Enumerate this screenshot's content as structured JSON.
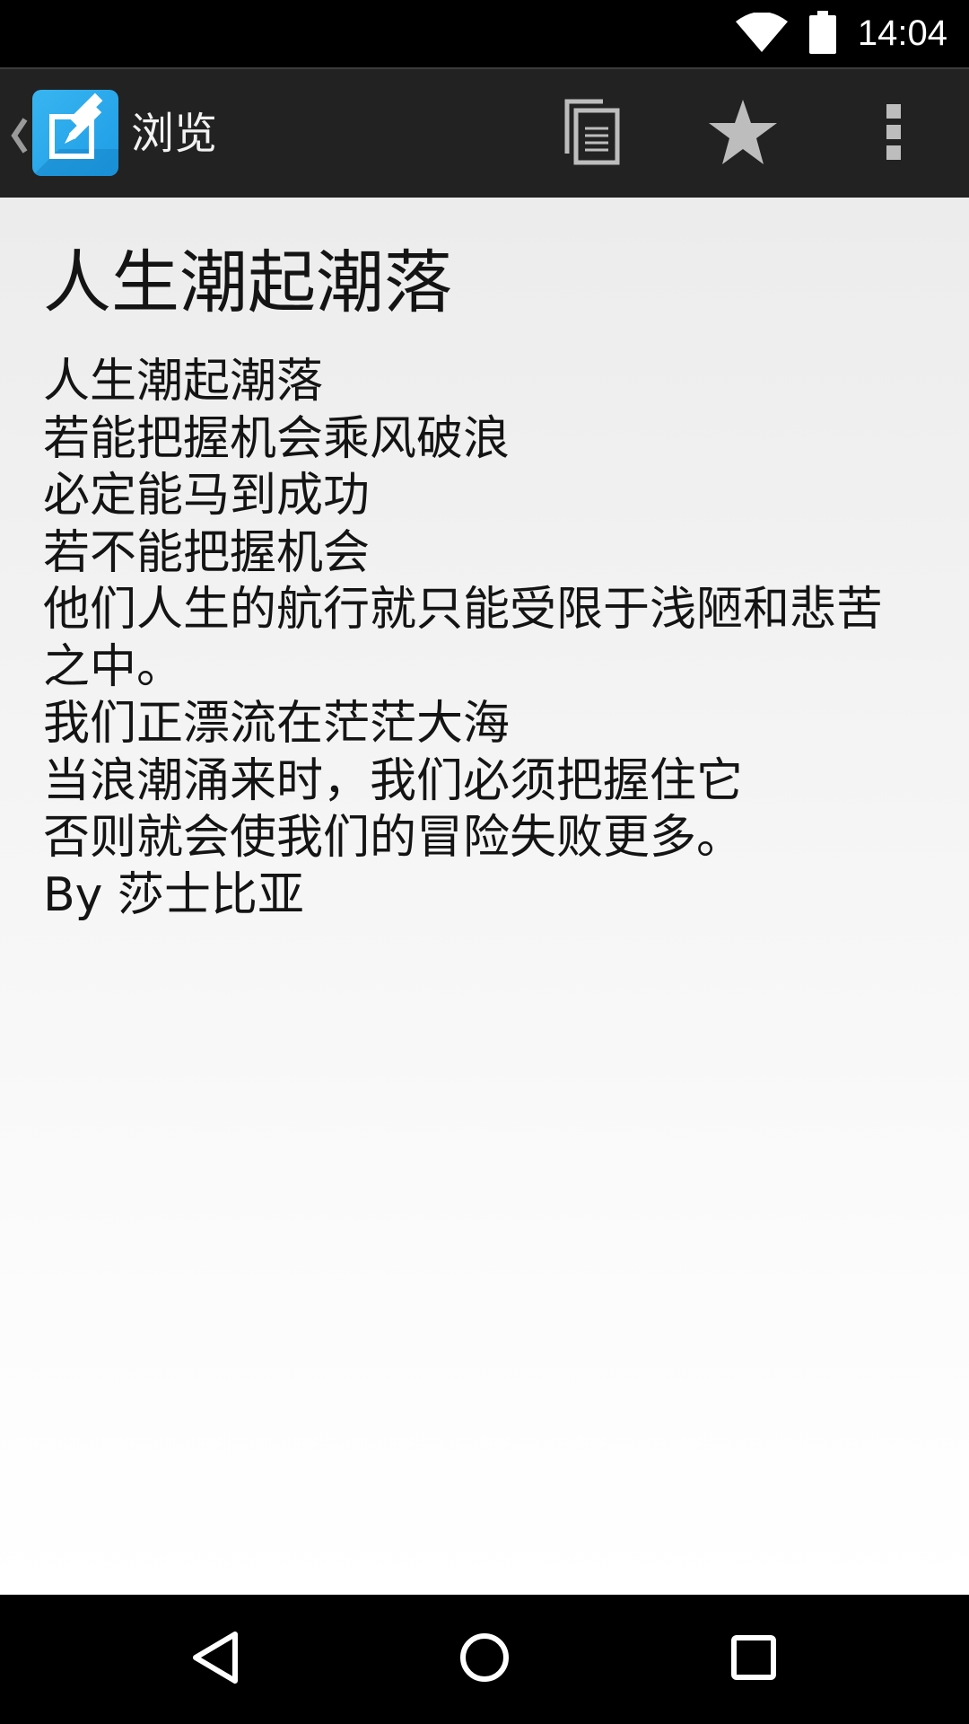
{
  "status_bar": {
    "time": "14:04",
    "icons": [
      "wifi-icon",
      "battery-icon"
    ]
  },
  "action_bar": {
    "title": "浏览",
    "icons": [
      "back-chevron-icon",
      "app-edit-icon",
      "copy-icon",
      "star-icon",
      "overflow-menu-icon"
    ]
  },
  "note": {
    "title": "人生潮起潮落",
    "lines": [
      "人生潮起潮落",
      "若能把握机会乘风破浪",
      "必定能马到成功",
      "若不能把握机会",
      "他们人生的航行就只能受限于浅陋和悲苦",
      "之中。",
      "我们正漂流在茫茫大海",
      "当浪潮涌来时，我们必须把握住它",
      "否则就会使我们的冒险失败更多。",
      "By 莎士比亚"
    ]
  },
  "nav_bar": {
    "icons": [
      "back-triangle-icon",
      "home-circle-icon",
      "recents-square-icon"
    ]
  }
}
